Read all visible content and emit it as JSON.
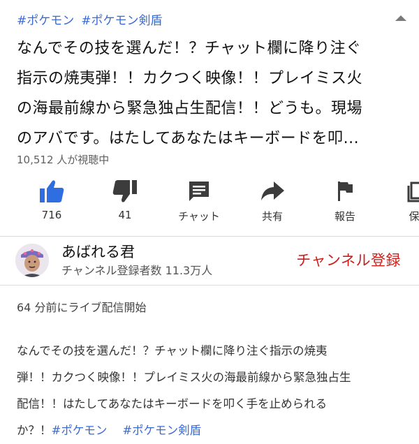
{
  "header": {
    "tags": [
      "#ポケモン",
      "#ポケモン剣盾"
    ]
  },
  "video": {
    "title_lines": [
      "なんでその技を選んだ！？チャット欄に降り注ぐ",
      "指示の焼夷弾！！カクつく映像！！プレイミス火",
      "の海最前線から緊急独占生配信！！どうも。現場",
      "のアバです。はたしてあなたはキーボードを叩..."
    ],
    "viewers": "10,512 人が視聴中"
  },
  "actions": [
    {
      "icon": "thumbs-up-icon",
      "label": "716",
      "color": "#2f6ee0"
    },
    {
      "icon": "thumbs-down-icon",
      "label": "41",
      "color": "#444444"
    },
    {
      "icon": "chat-icon",
      "label": "チャット",
      "color": "#444444"
    },
    {
      "icon": "share-icon",
      "label": "共有",
      "color": "#444444"
    },
    {
      "icon": "flag-icon",
      "label": "報告",
      "color": "#444444"
    },
    {
      "icon": "save-icon",
      "label": "保",
      "color": "#444444"
    }
  ],
  "channel": {
    "name": "あばれる君",
    "subscribers": "チャンネル登録者数 11.3万人",
    "subscribe_label": "チャンネル登録"
  },
  "description": {
    "started": "64 分前にライブ配信開始",
    "lines": [
      "なんでその技を選んだ！？チャット欄に降り注ぐ指示の焼夷",
      "弾！！カクつく映像！！プレイミス火の海最前線から緊急独占生",
      "配信！！はたしてあなたはキーボードを叩く手を止められる"
    ],
    "last_line_text": "か？！",
    "tags": [
      "#ポケモン",
      "#ポケモン剣盾"
    ]
  }
}
